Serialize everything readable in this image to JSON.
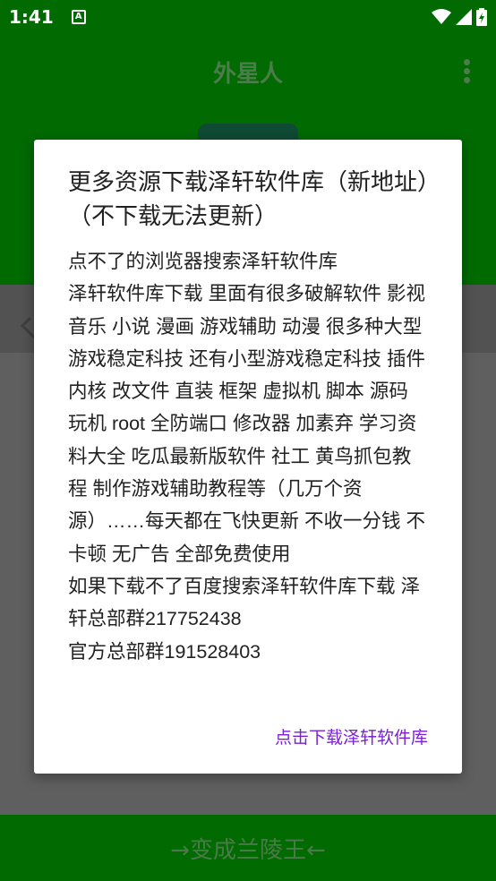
{
  "status_bar": {
    "time": "1:41",
    "notification_glyph": "A",
    "icons": [
      "notification-icon",
      "wifi-icon",
      "signal-icon",
      "battery-icon"
    ]
  },
  "app_bar": {
    "title": "外星人",
    "menu_icon": "more-vert-icon"
  },
  "dialog": {
    "title": "更多资源下载泽轩软件库（新地址）（不下载无法更新）",
    "body": [
      "点不了的浏览器搜索泽轩软件库",
      "泽轩软件库下载 里面有很多破解软件 影视 音乐 小说 漫画 游戏辅助 动漫 很多种大型游戏稳定科技 还有小型游戏稳定科技 插件 内核 改文件 直装 框架 虚拟机 脚本 源码 玩机 root 全防端口 修改器 加素弃 学习资料大全 吃瓜最新版软件 社工 黄鸟抓包教程 制作游戏辅助教程等（几万个资源）……每天都在飞快更新 不收一分钱 不卡顿 无广告 全部免费使用",
      "如果下载不了百度搜索泽轩软件库下载 泽轩总部群217752438",
      "官方总部群191528403"
    ],
    "action_label": "点击下载泽轩软件库"
  },
  "bottom_button": {
    "label": "→变成兰陵王←"
  },
  "colors": {
    "app_green": "#016a01",
    "scrim_gray": "#5f5f5f",
    "dialog_bg": "#ffffff",
    "action_purple": "#7b1fd6"
  }
}
